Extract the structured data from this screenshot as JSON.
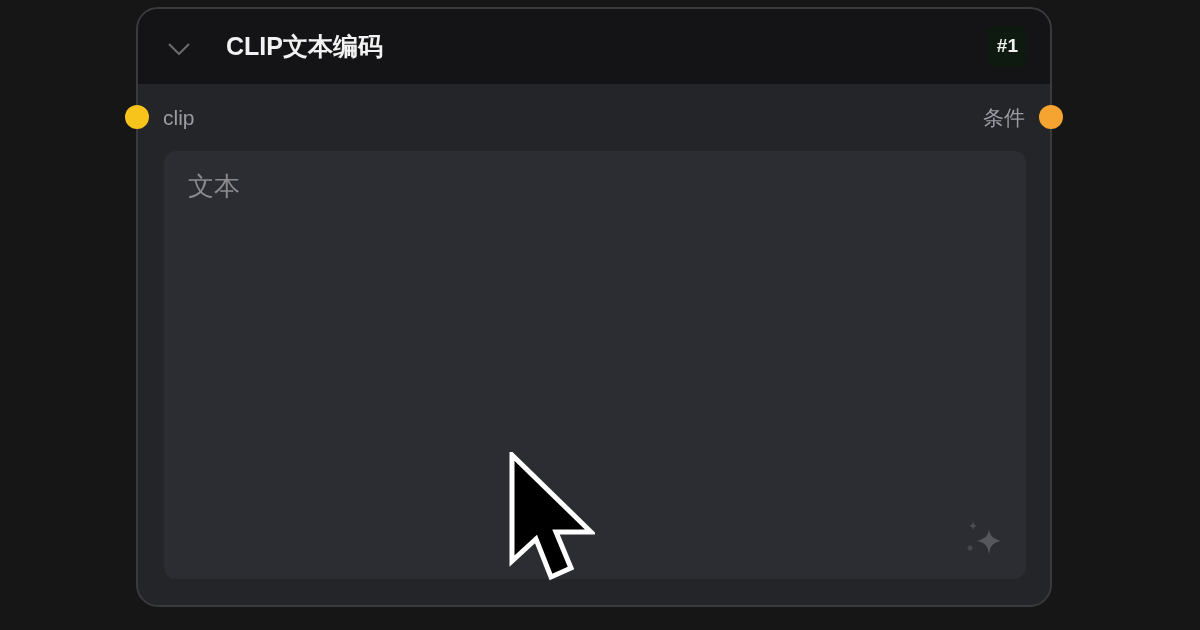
{
  "node": {
    "title": "CLIP文本编码",
    "expanded": true,
    "badge": "#1",
    "inputs": [
      {
        "label": "clip",
        "color": "#f7c41b"
      }
    ],
    "outputs": [
      {
        "label": "条件",
        "color": "#f5a431"
      }
    ],
    "widgets": [
      {
        "kind": "textarea",
        "placeholder": "文本"
      }
    ]
  }
}
